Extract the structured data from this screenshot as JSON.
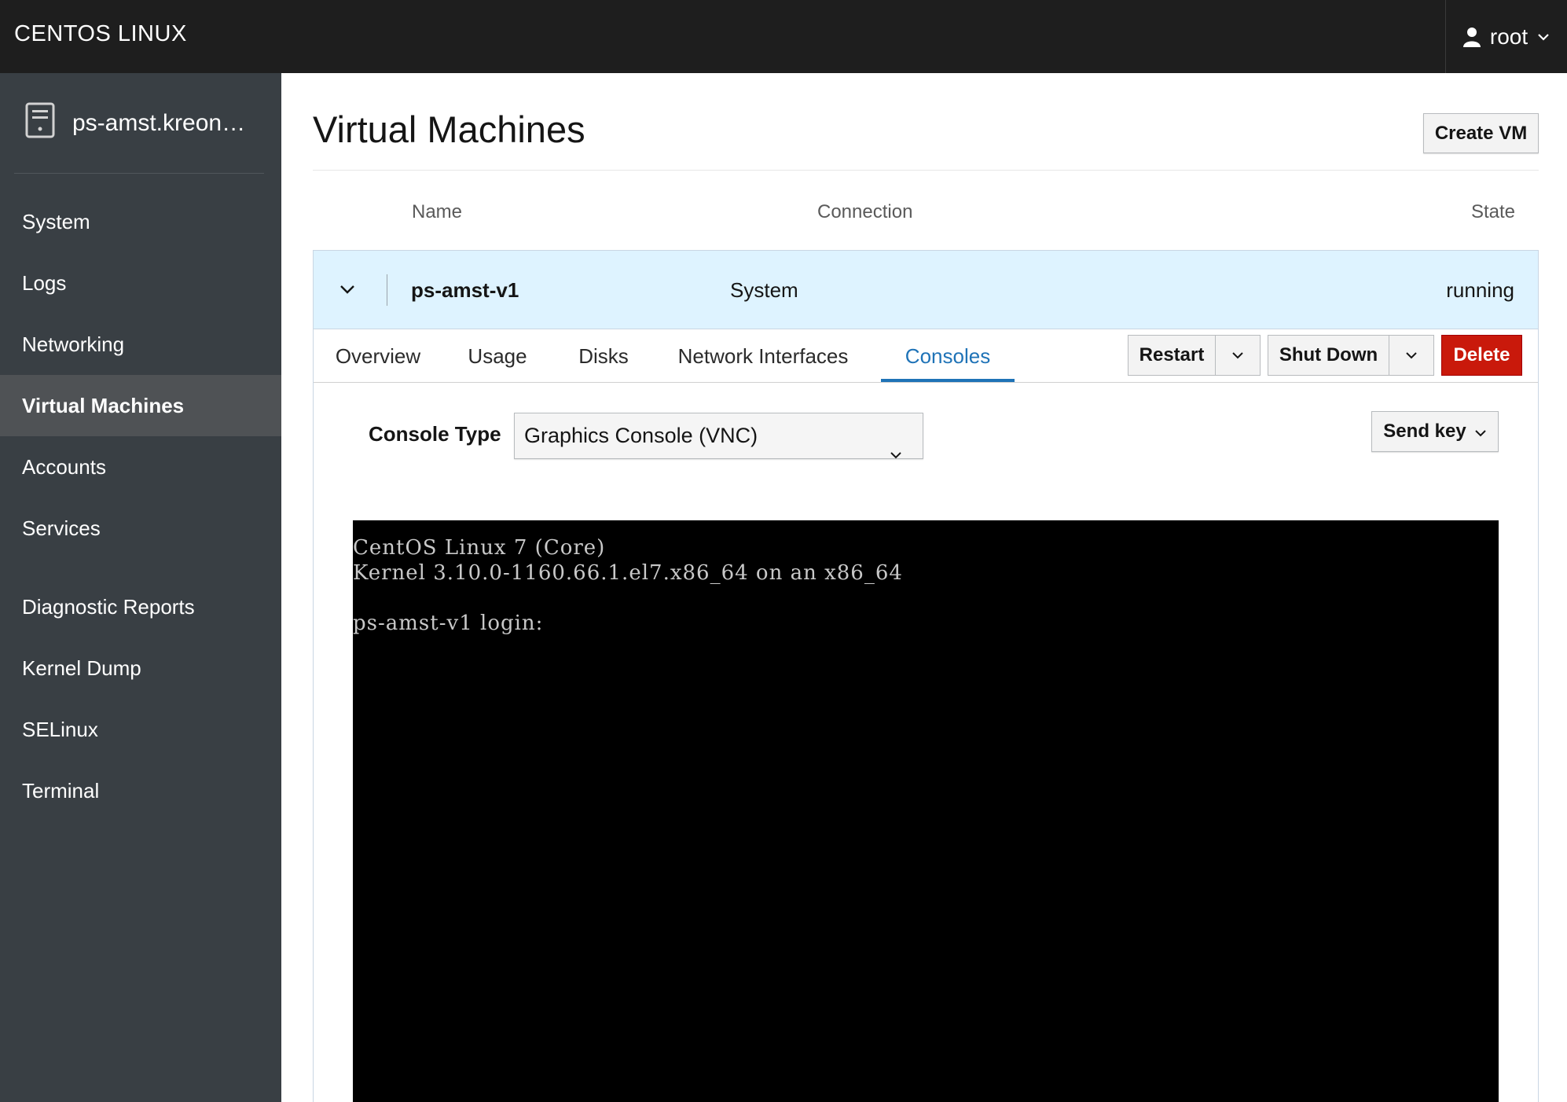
{
  "topbar": {
    "brand": "CENTOS LINUX",
    "user": "root",
    "icons": {
      "user": "user-icon",
      "menu": "chevron-down-icon"
    }
  },
  "sidebar": {
    "host": "ps-amst.kreone...",
    "host_icon": "server-icon",
    "items": [
      {
        "label": "System"
      },
      {
        "label": "Logs"
      },
      {
        "label": "Networking"
      },
      {
        "label": "Virtual Machines",
        "active": true
      },
      {
        "label": "Accounts"
      },
      {
        "label": "Services"
      },
      {
        "label": "Diagnostic Reports"
      },
      {
        "label": "Kernel Dump"
      },
      {
        "label": "SELinux"
      },
      {
        "label": "Terminal"
      }
    ]
  },
  "main": {
    "title": "Virtual Machines",
    "create_vm_label": "Create VM",
    "columns": {
      "name": "Name",
      "connection": "Connection",
      "state": "State"
    },
    "vm": {
      "name": "ps-amst-v1",
      "connection": "System",
      "state": "running",
      "tabs": [
        {
          "label": "Overview"
        },
        {
          "label": "Usage"
        },
        {
          "label": "Disks"
        },
        {
          "label": "Network Interfaces"
        },
        {
          "label": "Consoles",
          "active": true
        }
      ],
      "actions": {
        "restart": "Restart",
        "shutdown": "Shut Down",
        "delete": "Delete"
      },
      "console": {
        "type_label": "Console Type",
        "type_value": "Graphics Console (VNC)",
        "send_key_label": "Send key",
        "screen_lines": [
          "CentOS Linux 7 (Core)",
          "Kernel 3.10.0-1160.66.1.el7.x86_64 on an x86_64",
          "",
          "ps-amst-v1 login:"
        ]
      }
    }
  },
  "colors": {
    "topbar_bg": "#1e1e1e",
    "sidebar_bg": "#393f44",
    "sidebar_active_bg": "#4f5255",
    "row_selected_bg": "#def3ff",
    "tab_active": "#1f73b7",
    "danger": "#c9190b"
  }
}
